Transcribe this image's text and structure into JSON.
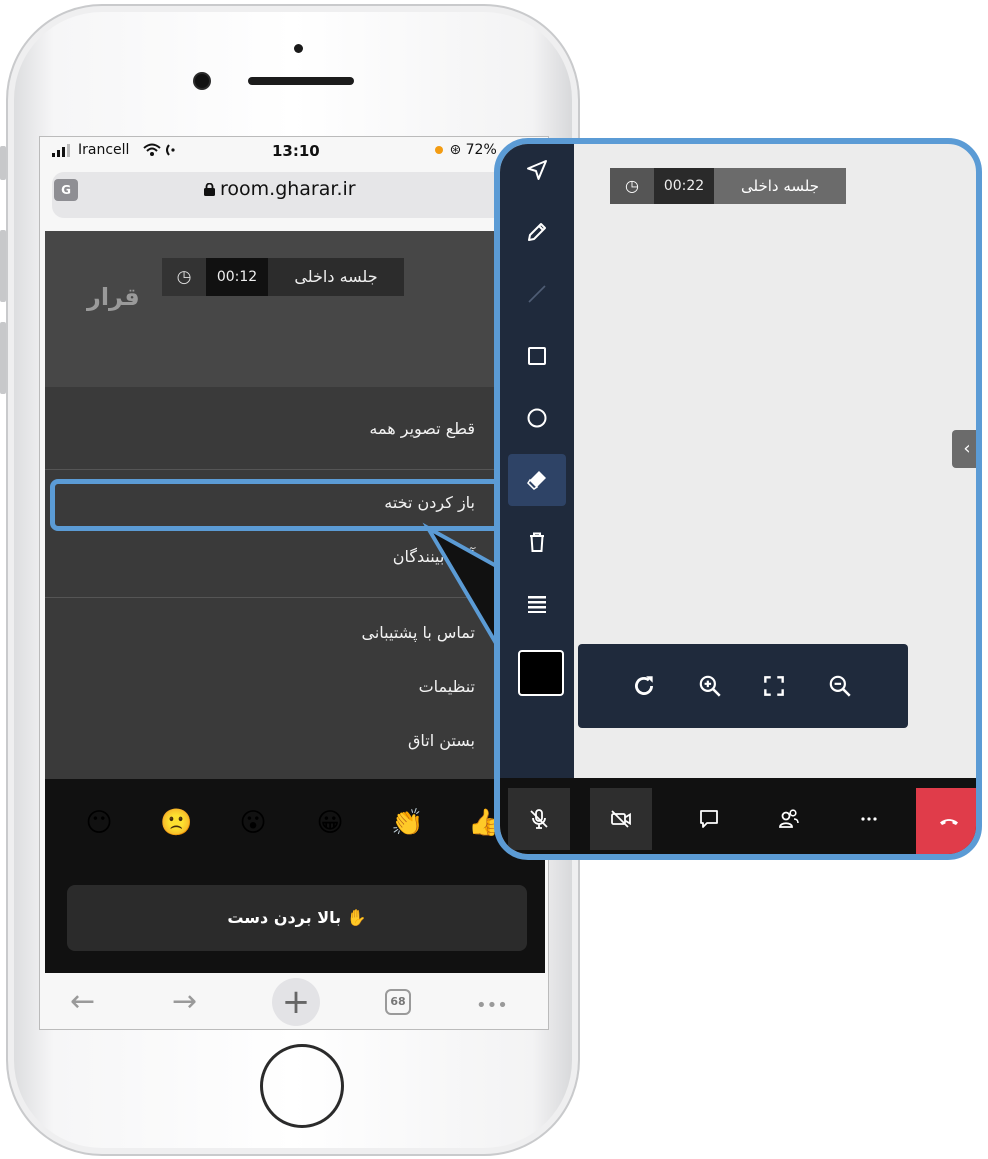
{
  "status_bar": {
    "carrier": "Irancell",
    "time": "13:10",
    "battery": "72%"
  },
  "url_bar": {
    "translate_icon": "G",
    "domain": "room.gharar.ir"
  },
  "room": {
    "logo_text": "قرار",
    "timer_small": {
      "elapsed": "00:12",
      "session_name": "جلسه داخلی"
    }
  },
  "menu": {
    "items": [
      "قطع تصویر همه",
      "باز کردن تخته",
      "آمار بینندگان",
      "تماس با پشتیبانی",
      "تنظیمات",
      "بستن اتاق"
    ]
  },
  "reactions": {
    "emojis": [
      "😶",
      "🙁",
      "😮",
      "😀",
      "👏",
      "👍"
    ]
  },
  "raise_hand": {
    "icon": "✋",
    "label": "بالا بردن دست"
  },
  "browser_bar": {
    "back": "←",
    "forward": "→",
    "new_tab": "+",
    "tab_count": "68",
    "more": "•••"
  },
  "whiteboard": {
    "timer": {
      "elapsed": "00:22",
      "session_name": "جلسه داخلی"
    },
    "side_toggle": "‹",
    "tools": [
      "pointer-icon",
      "pencil-icon",
      "line-icon",
      "rectangle-icon",
      "circle-icon",
      "eraser-icon",
      "trash-icon",
      "line-weight-icon"
    ],
    "active_tool": "eraser-icon",
    "stroke_color": "#000000",
    "zoom_controls": [
      "refresh-icon",
      "zoom-in-icon",
      "fullscreen-icon",
      "zoom-out-icon"
    ],
    "call_controls": [
      "mic-off-icon",
      "video-off-icon",
      "chat-icon",
      "participants-icon",
      "more-icon",
      "hangup-icon"
    ]
  },
  "colors": {
    "highlight": "#5b9bd5",
    "toolbar": "#1f2a3c",
    "hangup": "#e03c4a"
  }
}
